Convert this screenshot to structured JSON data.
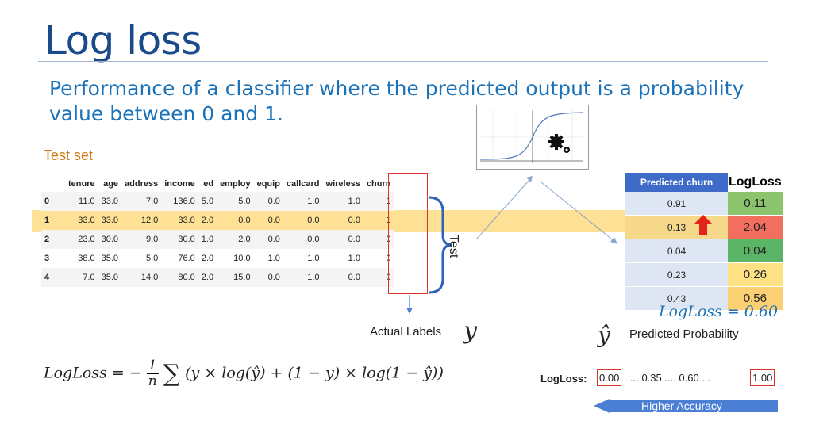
{
  "title": "Log loss",
  "subtitle": "Performance of a classifier where the predicted output is a probability value between 0 and 1.",
  "test_set_label": "Test set",
  "table": {
    "columns": [
      "",
      "tenure",
      "age",
      "address",
      "income",
      "ed",
      "employ",
      "equip",
      "callcard",
      "wireless",
      "churn"
    ],
    "rows": [
      [
        "0",
        "11.0",
        "33.0",
        "7.0",
        "136.0",
        "5.0",
        "5.0",
        "0.0",
        "1.0",
        "1.0",
        "1"
      ],
      [
        "1",
        "33.0",
        "33.0",
        "12.0",
        "33.0",
        "2.0",
        "0.0",
        "0.0",
        "0.0",
        "0.0",
        "1"
      ],
      [
        "2",
        "23.0",
        "30.0",
        "9.0",
        "30.0",
        "1.0",
        "2.0",
        "0.0",
        "0.0",
        "0.0",
        "0"
      ],
      [
        "3",
        "38.0",
        "35.0",
        "5.0",
        "76.0",
        "2.0",
        "10.0",
        "1.0",
        "1.0",
        "1.0",
        "0"
      ],
      [
        "4",
        "7.0",
        "35.0",
        "14.0",
        "80.0",
        "2.0",
        "15.0",
        "0.0",
        "1.0",
        "0.0",
        "0"
      ]
    ]
  },
  "test_label": "Test",
  "prediction_table": {
    "col_predicted": "Predicted churn",
    "col_logloss": "LogLoss",
    "rows": [
      {
        "p": "0.91",
        "ll": "0.11",
        "color": "#8cc46e"
      },
      {
        "p": "0.13",
        "ll": "2.04",
        "color": "#f26e5f"
      },
      {
        "p": "0.04",
        "ll": "0.04",
        "color": "#5bb567"
      },
      {
        "p": "0.23",
        "ll": "0.26",
        "color": "#fde184"
      },
      {
        "p": "0.43",
        "ll": "0.56",
        "color": "#fcd072"
      }
    ]
  },
  "logloss_result": "LogLoss = 0.60",
  "actual_labels": "Actual Labels",
  "y_symbol": "y",
  "yhat_symbol": "ŷ",
  "predicted_probability": "Predicted Probability",
  "formula": {
    "lhs": "LogLoss = −",
    "frac_top": "1",
    "frac_bottom": "n",
    "sigma": "∑",
    "body": "(y × log(ŷ) + (1 − y) × log(1 − ŷ))"
  },
  "scale": {
    "label": "LogLoss:",
    "zero": "0.00",
    "mid": "... 0.35 .... 0.60 ...",
    "one": "1.00"
  },
  "accuracy_label": "Higher Accuracy",
  "colors": {
    "title": "#1a4a8a",
    "subtitle": "#1b72b8",
    "accent_red": "#d9342b",
    "header_blue": "#3e6bc8",
    "arrow_blue": "#4a7fd4"
  }
}
